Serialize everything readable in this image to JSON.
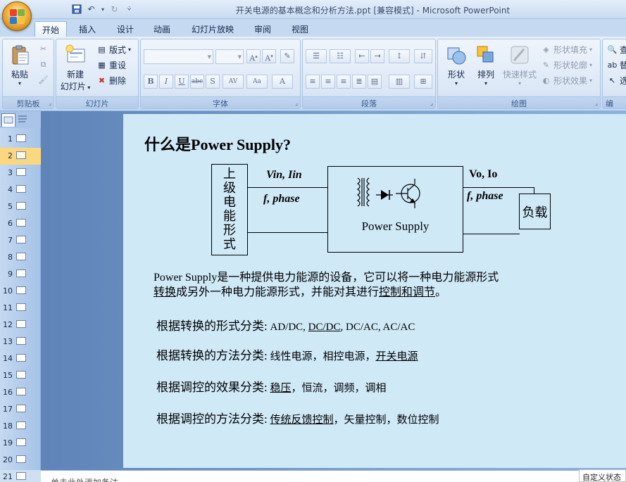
{
  "window": {
    "title": "开关电源的基本概念和分析方法.ppt [兼容模式] - Microsoft PowerPoint"
  },
  "qat": {
    "icons": [
      "save-icon",
      "undo-icon",
      "redo-icon",
      "customize-icon"
    ]
  },
  "tabs": [
    {
      "label": "开始",
      "active": true
    },
    {
      "label": "插入",
      "active": false
    },
    {
      "label": "设计",
      "active": false
    },
    {
      "label": "动画",
      "active": false
    },
    {
      "label": "幻灯片放映",
      "active": false
    },
    {
      "label": "审阅",
      "active": false
    },
    {
      "label": "视图",
      "active": false
    }
  ],
  "ribbon": {
    "clipboard": {
      "label": "剪贴板",
      "paste": "粘贴"
    },
    "slides": {
      "label": "幻灯片",
      "new_slide": "新建",
      "new_slide_2": "幻灯片",
      "layout": "版式",
      "reset": "重设",
      "delete": "删除"
    },
    "font": {
      "label": "字体"
    },
    "paragraph": {
      "label": "段落"
    },
    "drawing": {
      "label": "绘图",
      "shapes": "形状",
      "arrange": "排列",
      "quick_styles": "快速样式",
      "fill": "形状填充",
      "outline": "形状轮廓",
      "effects": "形状效果"
    },
    "editing": {
      "label": "编",
      "find": "查",
      "replace": "替",
      "select": "选"
    }
  },
  "slide_panel": {
    "selected": 2,
    "numbers": [
      "1",
      "2",
      "3",
      "4",
      "5",
      "6",
      "7",
      "8",
      "9",
      "10",
      "11",
      "12",
      "13",
      "14",
      "15",
      "16",
      "17",
      "18",
      "19",
      "20",
      "21"
    ]
  },
  "slide": {
    "title": "什么是Power Supply?",
    "diagram": {
      "source_chars": [
        "上",
        "级",
        "电",
        "能",
        "形",
        "式"
      ],
      "in_label_1": "Vin, Iin",
      "in_label_2": "f, phase",
      "ps_label": "Power Supply",
      "out_label_1": "Vo, Io",
      "out_label_2": "f, phase",
      "load_label": "负载"
    },
    "definition": {
      "line1": "Power Supply是一种提供电力能源的设备，它可以将一种电力能源形式",
      "line2_u1": "转换",
      "line2_mid": "成另外一种电力能源形式，并能对其进行",
      "line2_u2": "控制和调节",
      "line2_end": "。"
    },
    "classes": [
      {
        "lead": "根据转换的形式分类:",
        "items": [
          " AD/DC, ",
          "DC/DC",
          ", DC/AC, AC/AC"
        ],
        "underlined": [
          false,
          true,
          false
        ]
      },
      {
        "lead": "根据转换的方法分类:",
        "items": [
          " 线性电源，相控电源，",
          "开关电源",
          ""
        ],
        "underlined": [
          false,
          true,
          false
        ]
      },
      {
        "lead": "根据调控的效果分类:",
        "items": [
          " ",
          "稳压",
          "，恒流，调频，调相"
        ],
        "underlined": [
          false,
          true,
          false
        ]
      },
      {
        "lead": "根据调控的方法分类:",
        "items": [
          " ",
          "传统反馈控制",
          "，矢量控制，数位控制"
        ],
        "underlined": [
          false,
          true,
          false
        ]
      }
    ]
  },
  "notes": {
    "placeholder": "单击此处添加备注"
  },
  "status": {
    "text": "自定义状态"
  }
}
